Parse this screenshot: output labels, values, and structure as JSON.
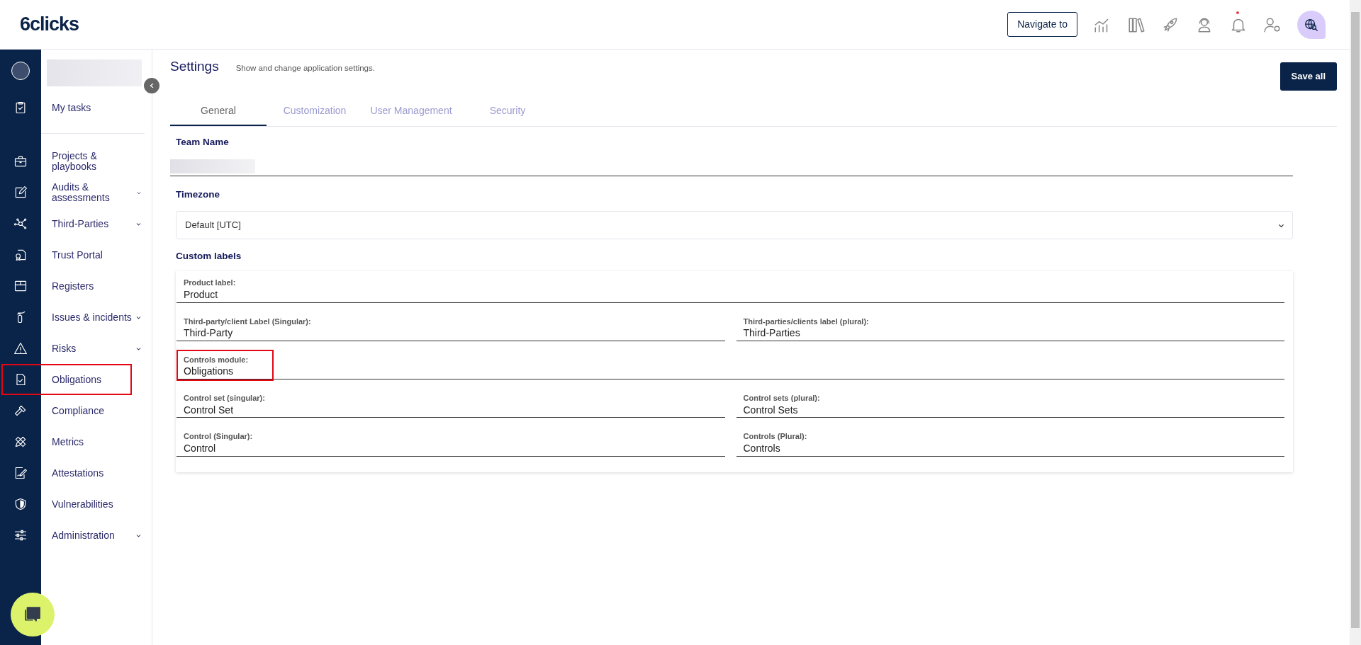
{
  "header": {
    "logo": "6clicks",
    "navigate_button": "Navigate to",
    "notifications_unread": true
  },
  "sidebar": {
    "top_item": "My tasks",
    "items": [
      {
        "label": "Projects & playbooks",
        "expandable": false,
        "highlighted": false
      },
      {
        "label": "Audits & assessments",
        "expandable": true,
        "highlighted": false
      },
      {
        "label": "Third-Parties",
        "expandable": true,
        "highlighted": false
      },
      {
        "label": "Trust Portal",
        "expandable": false,
        "highlighted": false
      },
      {
        "label": "Registers",
        "expandable": false,
        "highlighted": false
      },
      {
        "label": "Issues & incidents",
        "expandable": true,
        "highlighted": false
      },
      {
        "label": "Risks",
        "expandable": true,
        "highlighted": false
      },
      {
        "label": "Obligations",
        "expandable": false,
        "highlighted": true
      },
      {
        "label": "Compliance",
        "expandable": false,
        "highlighted": false
      },
      {
        "label": "Metrics",
        "expandable": false,
        "highlighted": false
      },
      {
        "label": "Attestations",
        "expandable": false,
        "highlighted": false
      },
      {
        "label": "Vulnerabilities",
        "expandable": false,
        "highlighted": false
      },
      {
        "label": "Administration",
        "expandable": true,
        "highlighted": false
      }
    ]
  },
  "page": {
    "title": "Settings",
    "subtitle": "Show and change application settings.",
    "save_button": "Save all"
  },
  "tabs": [
    {
      "label": "General",
      "selected": true
    },
    {
      "label": "Customization",
      "selected": false
    },
    {
      "label": "User Management",
      "selected": false
    },
    {
      "label": "Security",
      "selected": false
    }
  ],
  "team_name": {
    "label": "Team Name"
  },
  "timezone": {
    "label": "Timezone",
    "value": "Default [UTC]"
  },
  "custom_labels": {
    "title": "Custom labels",
    "rows": [
      [
        {
          "label": "Product label:",
          "value": "Product",
          "highlighted": false
        }
      ],
      [
        {
          "label": "Third-party/client Label (Singular):",
          "value": "Third-Party",
          "highlighted": false
        },
        {
          "label": "Third-parties/clients label (plural):",
          "value": "Third-Parties",
          "highlighted": false
        }
      ],
      [
        {
          "label": "Controls module:",
          "value": "Obligations",
          "highlighted": true
        }
      ],
      [
        {
          "label": "Control set (singular):",
          "value": "Control Set",
          "highlighted": false
        },
        {
          "label": "Control sets (plural):",
          "value": "Control Sets",
          "highlighted": false
        }
      ],
      [
        {
          "label": "Control (Singular):",
          "value": "Control",
          "highlighted": false
        },
        {
          "label": "Controls (Plural):",
          "value": "Controls",
          "highlighted": false
        }
      ]
    ]
  }
}
